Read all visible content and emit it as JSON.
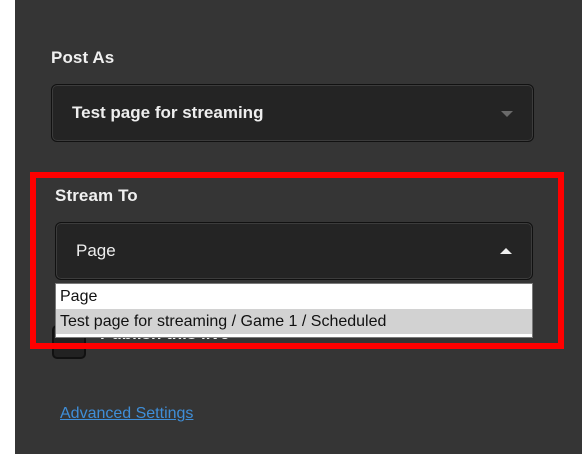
{
  "post_as": {
    "label": "Post As",
    "selected": "Test page for streaming"
  },
  "stream_to": {
    "label": "Stream To",
    "selected": "Page",
    "options": [
      "Page",
      "Test page for streaming / Game 1 / Scheduled"
    ]
  },
  "hidden_option": {
    "label": "Publish this live"
  },
  "advanced_settings_link": "Advanced Settings",
  "colors": {
    "panel_bg": "#353535",
    "highlight": "#ff0000",
    "link": "#3f8ed8"
  },
  "icons": {
    "post_as_caret": "chevron-down-icon",
    "stream_to_caret": "chevron-up-icon"
  }
}
